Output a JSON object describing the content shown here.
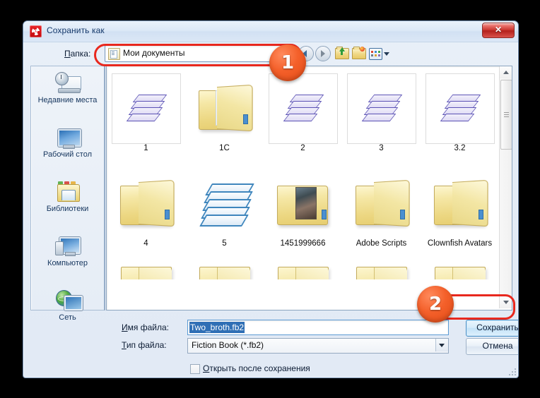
{
  "window": {
    "title": "Сохранить как",
    "app_icon": "app-red-icon",
    "close_label": "✕"
  },
  "toolbar": {
    "lookin_label": "Папка:",
    "lookin_label_accel": "П",
    "current_folder": "Мои документы",
    "folder_icon": "documents-folder-icon",
    "back_icon": "back-arrow-icon",
    "forward_icon": "forward-arrow-icon",
    "up_icon": "up-one-level-icon",
    "new_folder_icon": "new-folder-icon",
    "views_icon": "views-icon",
    "views_dropdown_icon": "chevron-down-icon"
  },
  "places": {
    "items": [
      {
        "label": "Недавние места",
        "icon": "recent-places-icon"
      },
      {
        "label": "Рабочий стол",
        "icon": "desktop-icon"
      },
      {
        "label": "Библиотеки",
        "icon": "libraries-icon"
      },
      {
        "label": "Компьютер",
        "icon": "computer-icon"
      },
      {
        "label": "Сеть",
        "icon": "network-icon"
      }
    ]
  },
  "filelist": {
    "rows": [
      [
        {
          "label": "1",
          "icon": "stacked-sheets-icon",
          "framed": true
        },
        {
          "label": "1C",
          "icon": "folder-documents-icon",
          "framed": false
        },
        {
          "label": "2",
          "icon": "stacked-sheets-icon",
          "framed": true
        },
        {
          "label": "3",
          "icon": "stacked-sheets-icon",
          "framed": true
        },
        {
          "label": "3.2",
          "icon": "stacked-sheets-icon",
          "framed": true
        }
      ],
      [
        {
          "label": "4",
          "icon": "folder-icon",
          "framed": false
        },
        {
          "label": "5",
          "icon": "layered-sheets-blue-icon",
          "framed": false
        },
        {
          "label": "1451999666",
          "icon": "folder-photo-icon",
          "framed": false
        },
        {
          "label": "Adobe Scripts",
          "icon": "folder-icon",
          "framed": false
        },
        {
          "label": "Clownfish Avatars",
          "icon": "folder-icon",
          "framed": false
        }
      ]
    ],
    "clipped_row_count": 5,
    "scrollbar": {
      "up_icon": "scroll-up-icon",
      "down_icon": "scroll-down-icon",
      "thumb": "scroll-thumb"
    }
  },
  "form": {
    "filename_label": "Имя файла:",
    "filename_label_accel": "И",
    "filename_value": "Two_broth.fb2",
    "filetype_label": "Тип файла:",
    "filetype_label_accel": "Т",
    "filetype_value": "Fiction Book (*.fb2)",
    "filetype_dropdown_icon": "chevron-down-icon",
    "checkbox_label": "Открыть после сохранения",
    "checkbox_label_accel": "О",
    "checkbox_checked": false,
    "save_label": "Сохранить",
    "cancel_label": "Отмена"
  },
  "annotations": {
    "colors": {
      "highlight": "#e8281e",
      "badge": "#f4602a"
    },
    "badges": [
      {
        "number": "1",
        "target": "lookin-combo"
      },
      {
        "number": "2",
        "target": "save-button"
      }
    ]
  }
}
